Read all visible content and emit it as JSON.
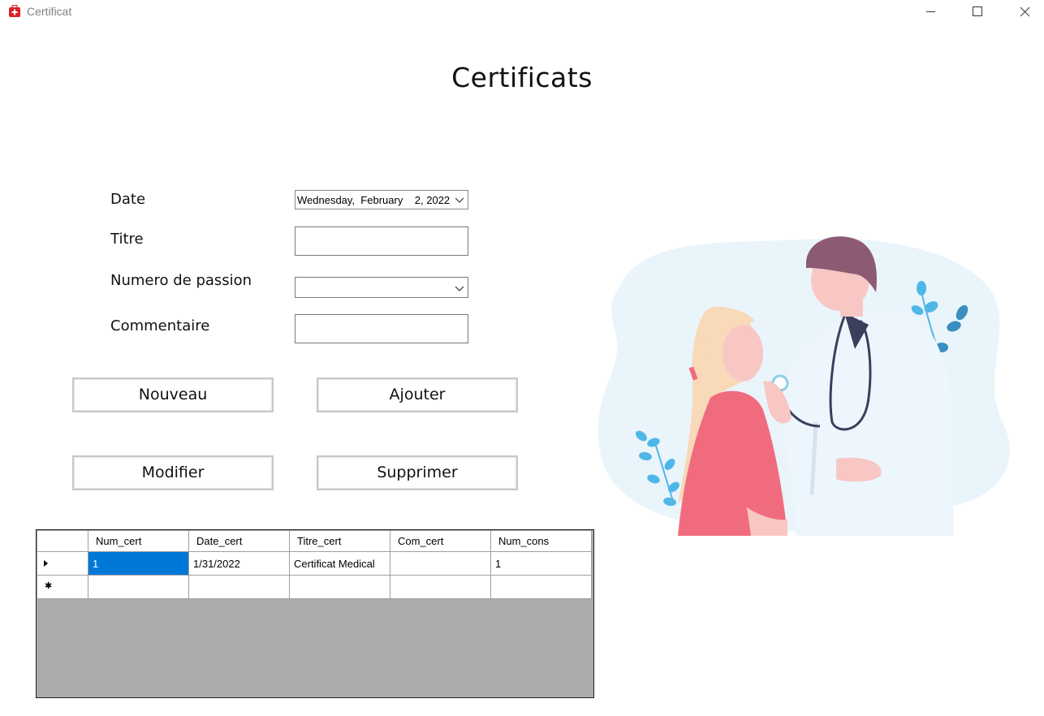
{
  "window": {
    "title": "Certificat",
    "icon": "medical-cross-icon",
    "controls": [
      "minimize-icon",
      "maximize-icon",
      "close-icon"
    ]
  },
  "page": {
    "title": "Certificats"
  },
  "form": {
    "date_label": "Date",
    "date_value": {
      "weekday": "Wednesday,",
      "month": "February",
      "rest": "2, 2022"
    },
    "titre_label": "Titre",
    "titre_value": "",
    "numero_label": "Numero de passion",
    "numero_value": "",
    "commentaire_label": "Commentaire",
    "commentaire_value": ""
  },
  "buttons": {
    "nouveau": "Nouveau",
    "ajouter": "Ajouter",
    "modifier": "Modifier",
    "supprimer": "Supprimer"
  },
  "grid": {
    "columns": [
      "Num_cert",
      "Date_cert",
      "Titre_cert",
      "Com_cert",
      "Num_cons"
    ],
    "rows": [
      [
        "1",
        "1/31/2022",
        "Certificat Medical",
        "",
        "1"
      ]
    ],
    "selection_color": "#0078d7",
    "empty_area_color": "#ababab"
  },
  "illustration": {
    "name": "doctor-patient-illustration",
    "colors": {
      "blob": "#eaf4fb",
      "leaf": "#4fb7e8",
      "doctor_hair": "#8c5a72",
      "patient_shirt": "#f16b7f",
      "skin": "#f8c7c4"
    }
  }
}
